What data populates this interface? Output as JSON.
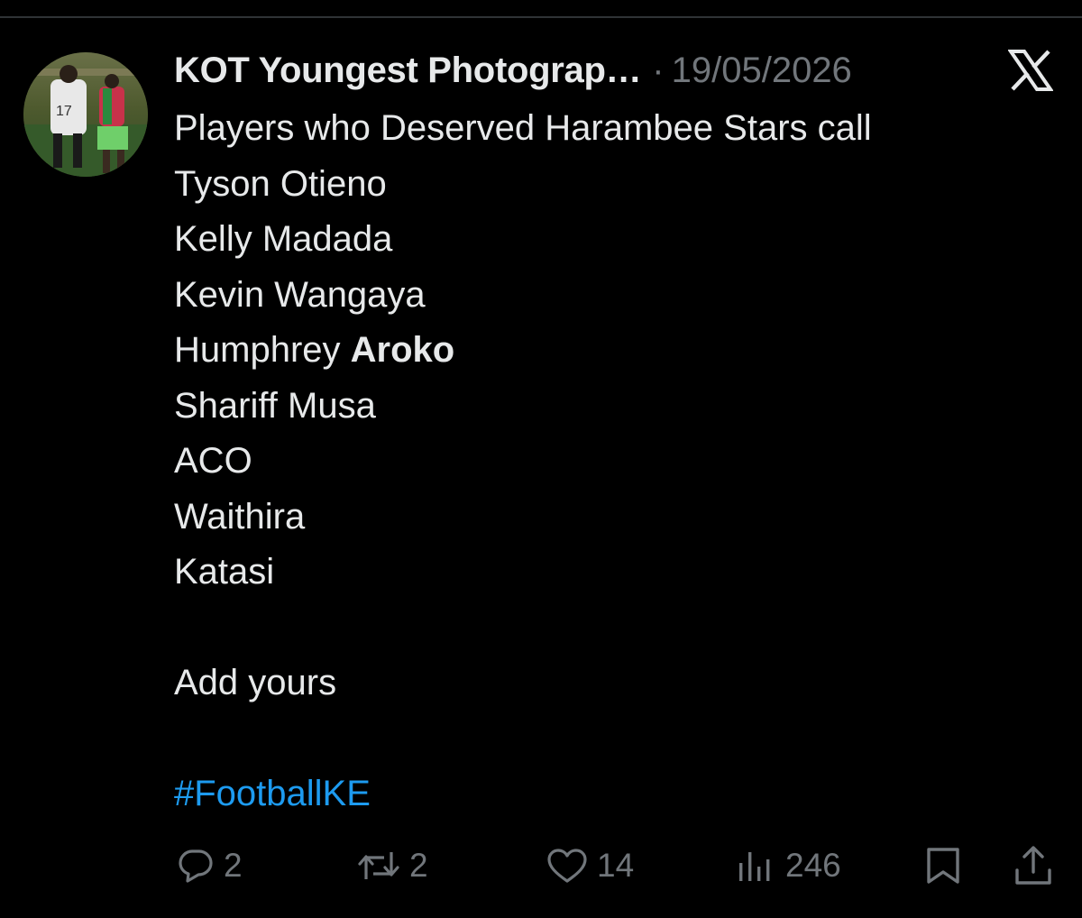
{
  "post": {
    "author": {
      "name": "KOT Youngest Photograp…",
      "avatar_icon": "avatar-photo"
    },
    "separator": "·",
    "date": "19/05/2026",
    "platform_icon": "x-logo-icon",
    "body": {
      "line1": "Players who Deserved Harambee Stars call",
      "line2": "Tyson Otieno",
      "line3": "Kelly Madada",
      "line4": "Kevin Wangaya",
      "line5_prefix": "Humphrey ",
      "line5_bold": "Aroko",
      "line6": "Shariff Musa",
      "line7": "ACO",
      "line8": "Waithira",
      "line9": "Katasi",
      "line10": "Add yours",
      "hashtag": "#FootballKE"
    },
    "actions": {
      "replies": "2",
      "reposts": "2",
      "likes": "14",
      "views": "246"
    }
  },
  "colors": {
    "background": "#000000",
    "text_primary": "#e7e9ea",
    "text_secondary": "#71767b",
    "link": "#1d9bf0"
  }
}
